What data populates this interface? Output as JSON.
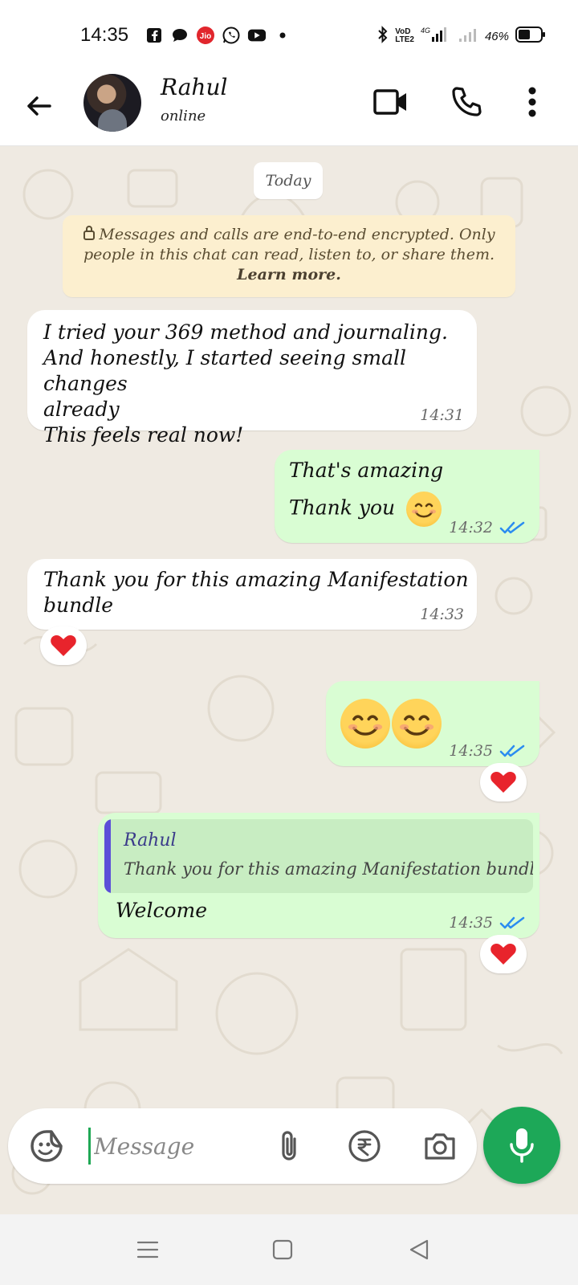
{
  "status_bar": {
    "time": "14:35",
    "battery": "46%",
    "network": "4G",
    "volte": "VoLTE",
    "left_icons": [
      "facebook-icon",
      "chat-bubble-icon",
      "jio-icon",
      "whatsapp-icon",
      "youtube-icon",
      "dot-icon"
    ],
    "right_icons": [
      "bluetooth-icon",
      "signal-icon",
      "battery-icon"
    ]
  },
  "header": {
    "contact_name": "Rahul",
    "status": "online",
    "actions": [
      "back-arrow-icon",
      "video-call-icon",
      "voice-call-icon",
      "more-options-icon"
    ]
  },
  "chat": {
    "date_chip": "Today",
    "encryption_notice": {
      "text": "Messages and calls are end-to-end encrypted. Only people in this chat can read, listen to, or share them.",
      "link": "Learn more."
    },
    "messages": [
      {
        "direction": "incoming",
        "lines": [
          "I tried your 369 method and journaling.",
          "And honestly, I started seeing small changes",
          "already",
          "This feels real now!"
        ],
        "time": "14:31"
      },
      {
        "direction": "outgoing",
        "lines": [
          "That's amazing",
          "Thank you"
        ],
        "emoji": "smiling-face",
        "time": "14:32",
        "read": true
      },
      {
        "direction": "incoming",
        "lines": [
          "Thank you for this amazing Manifestation",
          "bundle"
        ],
        "time": "14:33",
        "reaction": "heart"
      },
      {
        "direction": "outgoing",
        "emojis": [
          "smiling-face",
          "smiling-face"
        ],
        "time": "14:35",
        "read": true,
        "reaction": "heart"
      },
      {
        "direction": "outgoing",
        "quote": {
          "name": "Rahul",
          "text": "Thank you for this amazing Manifestation bundle"
        },
        "lines": [
          "Welcome"
        ],
        "time": "14:35",
        "read": true,
        "reaction": "heart"
      }
    ]
  },
  "composer": {
    "placeholder": "Message",
    "icons": [
      "sticker-icon",
      "attachment-icon",
      "rupee-payment-icon",
      "camera-icon",
      "microphone-icon"
    ]
  },
  "colors": {
    "chat_bg": "#efeae2",
    "outgoing_bubble": "#d9fdd3",
    "incoming_bubble": "#ffffff",
    "notice_bg": "#fcefcf",
    "accent_green": "#1da858",
    "read_tick": "#2b8cf0",
    "heart": "#e8242c"
  }
}
